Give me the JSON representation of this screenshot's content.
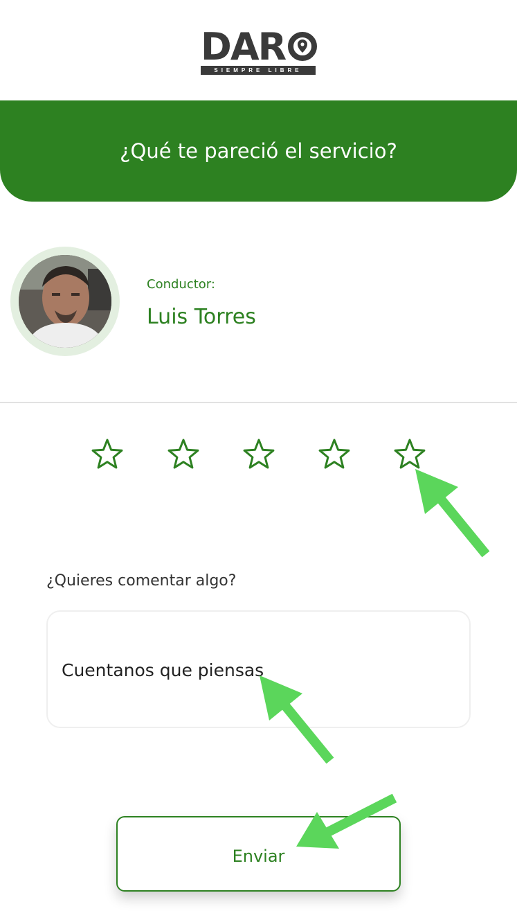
{
  "logo": {
    "word": "DARO",
    "tagline": "SIEMPRE LIBRE"
  },
  "header": {
    "title": "¿Qué te pareció el servicio?"
  },
  "driver": {
    "label": "Conductor:",
    "name": "Luis Torres"
  },
  "rating": {
    "max": 5,
    "value": 0,
    "icon": "star-outline-icon"
  },
  "comment": {
    "label": "¿Quieres comentar algo?",
    "placeholder": "Cuentanos que piensas"
  },
  "submit": {
    "label": "Enviar"
  },
  "colors": {
    "primary": "#2d8121",
    "annotation_arrow": "#5bd65b"
  }
}
